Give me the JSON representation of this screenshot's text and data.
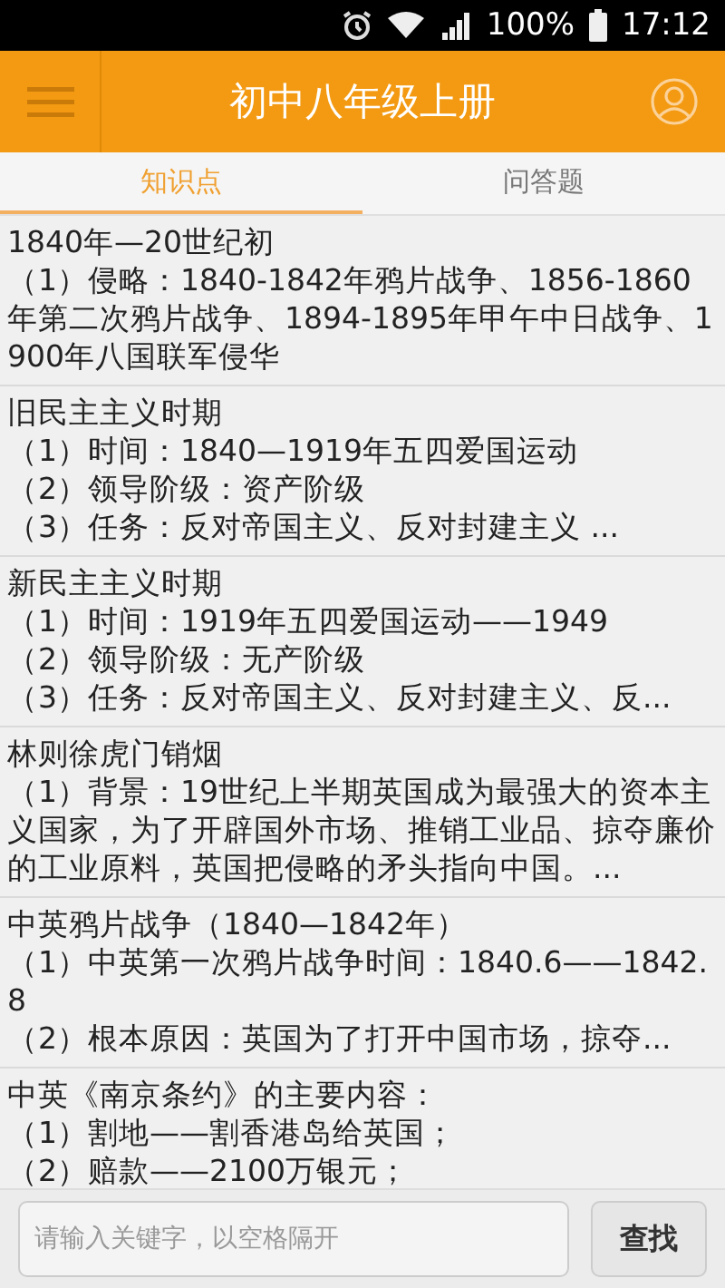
{
  "status_bar": {
    "battery": "100%",
    "time": "17:12"
  },
  "header": {
    "title": "初中八年级上册"
  },
  "tabs": [
    {
      "label": "知识点",
      "selected": true
    },
    {
      "label": "问答题",
      "selected": false
    }
  ],
  "items": [
    {
      "title": "1840年—20世纪初",
      "lines": [
        "（1）侵略：1840-1842年鸦片战争、1856-1860年第二次鸦片战争、1894-1895年甲午中日战争、1900年八国联军侵华"
      ]
    },
    {
      "title": "旧民主主义时期",
      "lines": [
        "（1）时间：1840—1919年五四爱国运动",
        "（2）领导阶级：资产阶级",
        "（3）任务：反对帝国主义、反对封建主义 ..."
      ]
    },
    {
      "title": "新民主主义时期",
      "lines": [
        "（1）时间：1919年五四爱国运动——1949",
        "（2）领导阶级：无产阶级",
        "（3）任务：反对帝国主义、反对封建主义、反..."
      ]
    },
    {
      "title": "林则徐虎门销烟",
      "lines": [
        "（1）背景：19世纪上半期英国成为最强大的资本主义国家，为了开辟国外市场、推销工业品、掠夺廉价的工业原料，英国把侵略的矛头指向中国。..."
      ]
    },
    {
      "title": "中英鸦片战争（1840—1842年）",
      "lines": [
        "（1）中英第一次鸦片战争时间：1840.6——1842.8",
        "（2）根本原因：英国为了打开中国市场，掠夺..."
      ]
    },
    {
      "title": "中英《南京条约》的主要内容：",
      "lines": [
        "（1）割地——割香港岛给英国；",
        "（2）赔款——2100万银元；"
      ]
    }
  ],
  "search": {
    "placeholder": "请输入关键字，以空格隔开",
    "button": "查找"
  }
}
